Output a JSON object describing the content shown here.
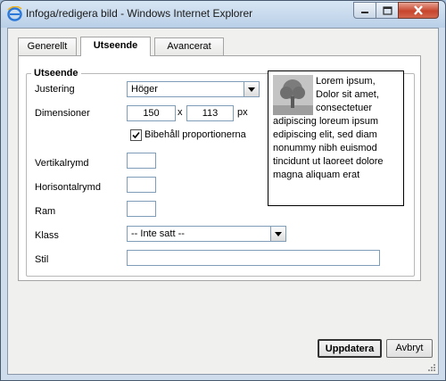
{
  "window": {
    "title": "Infoga/redigera bild - Windows Internet Explorer",
    "controls": [
      "minimize-icon",
      "maximize-icon",
      "close-icon"
    ]
  },
  "tabs": [
    {
      "label": "Generellt",
      "active": false
    },
    {
      "label": "Utseende",
      "active": true
    },
    {
      "label": "Avancerat",
      "active": false
    }
  ],
  "group": {
    "legend": "Utseende",
    "alignment": {
      "label": "Justering",
      "value": "Höger"
    },
    "dimensions": {
      "label": "Dimensioner",
      "width": "150",
      "separator": "x",
      "height": "113",
      "unit": "px"
    },
    "constrain": {
      "label": "Bibehåll proportionerna",
      "checked": true
    },
    "vspace": {
      "label": "Vertikalrymd",
      "value": ""
    },
    "hspace": {
      "label": "Horisontalrymd",
      "value": ""
    },
    "border": {
      "label": "Ram",
      "value": ""
    },
    "class": {
      "label": "Klass",
      "value": "-- Inte satt --"
    },
    "style": {
      "label": "Stil",
      "value": ""
    },
    "preview_text": "Lorem ipsum, Dolor sit amet, consectetuer adipiscing loreum ipsum edipiscing elit, sed diam nonummy nibh euismod tincidunt ut laoreet dolore magna aliquam erat"
  },
  "buttons": {
    "update": "Uppdatera",
    "cancel": "Avbryt"
  },
  "colors": {
    "window_frame": "#b9cfe7",
    "close_button": "#c7452c",
    "input_border": "#7f9db9"
  }
}
